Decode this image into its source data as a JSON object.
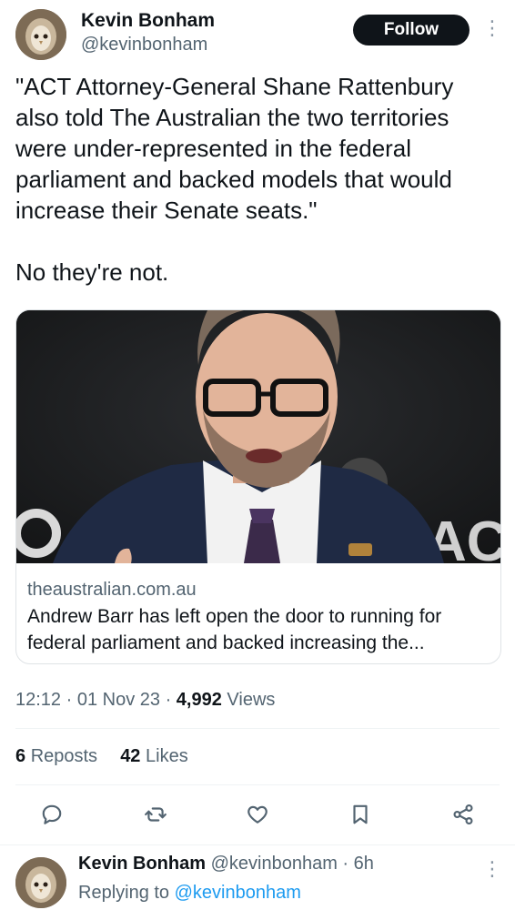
{
  "tweet": {
    "author_name": "Kevin Bonham",
    "author_handle": "@kevinbonham",
    "follow_label": "Follow",
    "text": "\"ACT Attorney-General Shane Rattenbury also told The Australian the two territories were under-represented in the federal parliament and backed models that would increase their Senate seats.\"\n\nNo they're not.",
    "card": {
      "domain": "theaustralian.com.au",
      "title": "Andrew Barr has left open the door to running for federal parliament and backed increasing the...",
      "image_sign_text": "AC"
    },
    "meta": {
      "time": "12:12",
      "date": "01 Nov 23",
      "views_count": "4,992",
      "views_label": "Views"
    },
    "stats": {
      "reposts_count": "6",
      "reposts_label": "Reposts",
      "likes_count": "42",
      "likes_label": "Likes"
    },
    "actions": [
      "reply-icon",
      "repost-icon",
      "like-icon",
      "bookmark-icon",
      "share-icon"
    ]
  },
  "reply": {
    "author_name": "Kevin Bonham",
    "author_handle": "@kevinbonham",
    "age": "6h",
    "replying_prefix": "Replying to",
    "replying_to": "@kevinbonham"
  },
  "colors": {
    "text": "#0f1419",
    "secondary": "#536471",
    "link": "#1d9bf0",
    "divider": "#eff3f4"
  }
}
